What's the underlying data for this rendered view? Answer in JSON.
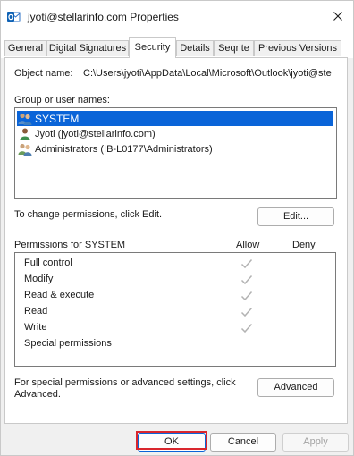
{
  "window": {
    "title": "jyoti@stellarinfo.com Properties",
    "icon": "outlook-icon"
  },
  "tabs": [
    {
      "label": "General"
    },
    {
      "label": "Digital Signatures"
    },
    {
      "label": "Security"
    },
    {
      "label": "Details"
    },
    {
      "label": "Seqrite"
    },
    {
      "label": "Previous Versions"
    }
  ],
  "active_tab": "Security",
  "object": {
    "label": "Object name:",
    "value": "C:\\Users\\jyoti\\AppData\\Local\\Microsoft\\Outlook\\jyoti@ste"
  },
  "groups": {
    "label": "Group or user names:",
    "items": [
      {
        "name": "SYSTEM",
        "icon": "users-group-icon",
        "selected": true
      },
      {
        "name": "Jyoti (jyoti@stellarinfo.com)",
        "icon": "user-icon",
        "selected": false
      },
      {
        "name": "Administrators (IB-L0177\\Administrators)",
        "icon": "users-group-icon",
        "selected": false
      }
    ]
  },
  "change_permissions": {
    "text": "To change permissions, click Edit.",
    "edit_button": "Edit..."
  },
  "permissions": {
    "header": "Permissions for SYSTEM",
    "allow_label": "Allow",
    "deny_label": "Deny",
    "rows": [
      {
        "name": "Full control",
        "allow": true,
        "deny": false
      },
      {
        "name": "Modify",
        "allow": true,
        "deny": false
      },
      {
        "name": "Read & execute",
        "allow": true,
        "deny": false
      },
      {
        "name": "Read",
        "allow": true,
        "deny": false
      },
      {
        "name": "Write",
        "allow": true,
        "deny": false
      },
      {
        "name": "Special permissions",
        "allow": false,
        "deny": false
      }
    ]
  },
  "advanced": {
    "text_line1": "For special permissions or advanced settings, click",
    "text_line2": "Advanced.",
    "button": "Advanced"
  },
  "footer": {
    "ok": "OK",
    "cancel": "Cancel",
    "apply": "Apply"
  },
  "colors": {
    "selection": "#0a64d8",
    "highlight_border": "#d9262d",
    "check_gray": "#b3b3b3",
    "disabled_text": "#a0a0a0"
  }
}
